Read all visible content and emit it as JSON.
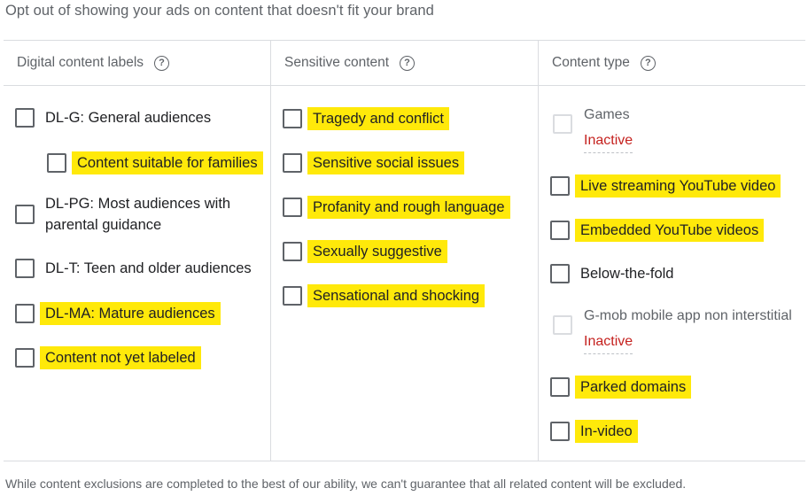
{
  "intro": "Opt out of showing your ads on content that doesn't fit your brand",
  "columns": {
    "digital": {
      "title": "Digital content labels",
      "items": [
        {
          "label": "DL-G: General audiences",
          "highlighted": false
        },
        {
          "label": "Content suitable for families",
          "highlighted": true
        },
        {
          "label": "DL-PG: Most audiences with parental guidance",
          "highlighted": false
        },
        {
          "label": "DL-T: Teen and older audiences",
          "highlighted": false
        },
        {
          "label": "DL-MA: Mature audiences",
          "highlighted": true
        },
        {
          "label": "Content not yet labeled",
          "highlighted": true
        }
      ]
    },
    "sensitive": {
      "title": "Sensitive content",
      "items": [
        {
          "label": "Tragedy and conflict",
          "highlighted": true
        },
        {
          "label": "Sensitive social issues",
          "highlighted": true
        },
        {
          "label": "Profanity and rough language",
          "highlighted": true
        },
        {
          "label": "Sexually suggestive",
          "highlighted": true
        },
        {
          "label": "Sensational and shocking",
          "highlighted": true
        }
      ]
    },
    "content_type": {
      "title": "Content type",
      "items": [
        {
          "label": "Games",
          "disabled": true,
          "status": "Inactive"
        },
        {
          "label": "Live streaming YouTube video",
          "highlighted": true
        },
        {
          "label": "Embedded YouTube videos",
          "highlighted": true
        },
        {
          "label": "Below-the-fold",
          "highlighted": false
        },
        {
          "label": "G-mob mobile app non interstitial",
          "disabled": true,
          "status": "Inactive"
        },
        {
          "label": "Parked domains",
          "highlighted": true
        },
        {
          "label": "In-video",
          "highlighted": true
        }
      ]
    }
  },
  "help_icon": "help-circle-icon",
  "colors": {
    "highlight": "#ffe90a",
    "inactive": "#c5221f",
    "border": "#dadce0",
    "muted_text": "#5f6368"
  },
  "footer_note": "While content exclusions are completed to the best of our ability, we can't guarantee that all related content will be excluded."
}
